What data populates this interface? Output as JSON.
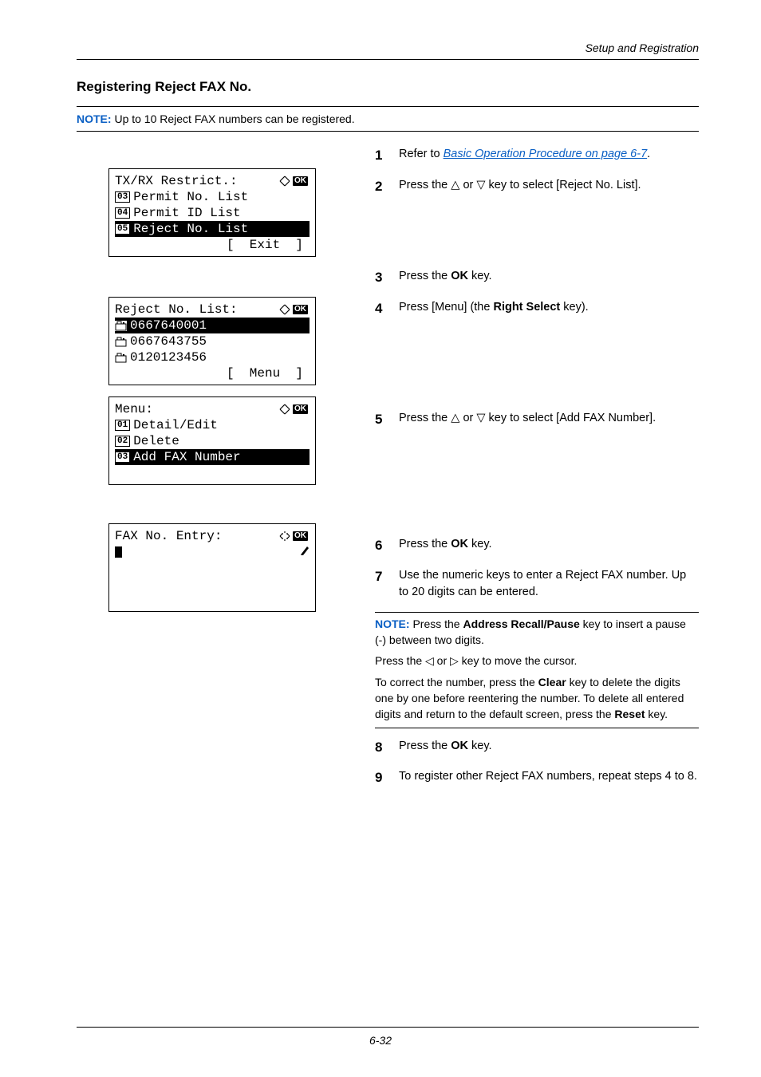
{
  "header": {
    "section": "Setup and Registration"
  },
  "heading": "Registering Reject FAX No.",
  "top_note": {
    "label": "NOTE:",
    "text": " Up to 10 Reject FAX numbers can be registered."
  },
  "lcd1": {
    "title": "TX/RX Restrict.:",
    "ok": "OK",
    "r1_num": "03",
    "r1_text": "Permit No. List",
    "r2_num": "04",
    "r2_text": "Permit ID List",
    "r3_num": "05",
    "r3_text": "Reject No. List",
    "soft": "[  Exit  ]"
  },
  "lcd2": {
    "title": "Reject No. List:",
    "ok": "OK",
    "r1": "0667640001",
    "r2": "0667643755",
    "r3": "0120123456",
    "soft": "[  Menu  ]"
  },
  "lcd3": {
    "title": "Menu:",
    "ok": "OK",
    "r1_num": "01",
    "r1_text": "Detail/Edit",
    "r2_num": "02",
    "r2_text": "Delete",
    "r3_num": "03",
    "r3_text": "Add FAX Number"
  },
  "lcd4": {
    "title": "FAX No. Entry:",
    "ok": "OK"
  },
  "steps": {
    "s1_num": "1",
    "s1_a": "Refer to ",
    "s1_link": "Basic Operation Procedure on page 6-7",
    "s1_b": ".",
    "s2_num": "2",
    "s2": "Press the △ or ▽ key to select [Reject No. List].",
    "s3_num": "3",
    "s3_a": "Press the ",
    "s3_b": "OK",
    "s3_c": " key.",
    "s4_num": "4",
    "s4_a": "Press [Menu] (the ",
    "s4_b": "Right Select",
    "s4_c": " key).",
    "s5_num": "5",
    "s5": "Press the △ or ▽ key to select [Add FAX Number].",
    "s6_num": "6",
    "s6_a": "Press the ",
    "s6_b": "OK",
    "s6_c": " key.",
    "s7_num": "7",
    "s7": "Use the numeric keys to enter a Reject FAX number. Up to 20 digits can be entered.",
    "s8_num": "8",
    "s8_a": "Press the ",
    "s8_b": "OK",
    "s8_c": " key.",
    "s9_num": "9",
    "s9": "To register other Reject FAX numbers, repeat steps 4 to 8."
  },
  "interior_note": {
    "label": "NOTE:",
    "p1_a": " Press the ",
    "p1_b": "Address Recall/Pause",
    "p1_c": " key to insert a pause (-) between two digits.",
    "p2": "Press the ◁ or ▷ key to move the cursor.",
    "p3_a": "To correct the number, press the ",
    "p3_b": "Clear",
    "p3_c": " key to delete the digits one by one before reentering the number. To delete all entered digits and return to the default screen, press the ",
    "p3_d": "Reset",
    "p3_e": " key."
  },
  "footer": {
    "page": "6-32"
  }
}
